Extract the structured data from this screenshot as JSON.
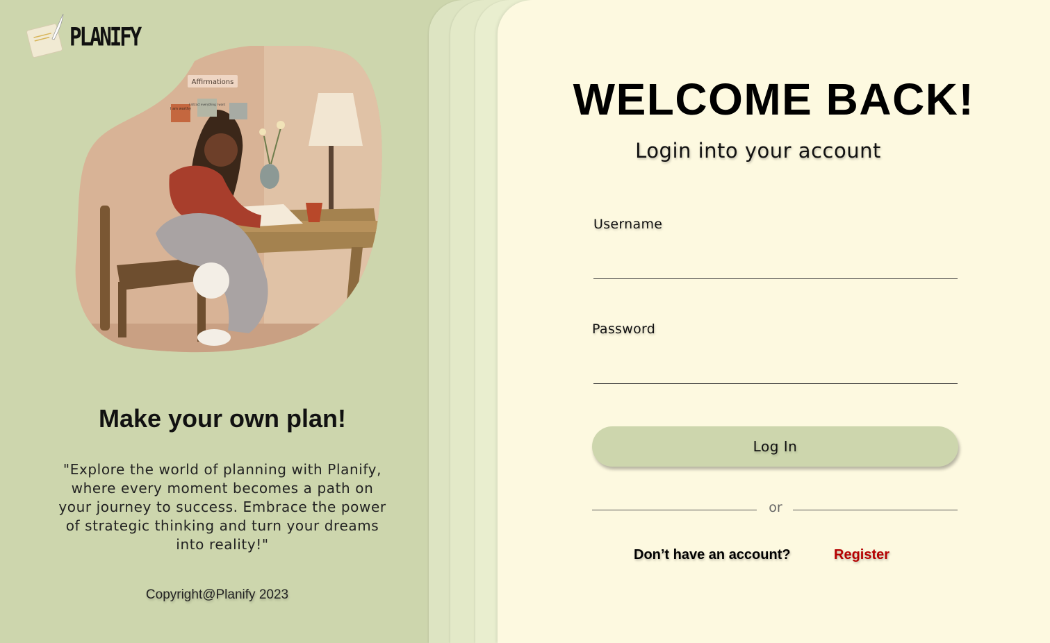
{
  "brand": {
    "name": "PLANIFY",
    "logo_icon": "notepad-quill-icon"
  },
  "illustration": {
    "icon": "woman-writing-at-desk-illustration",
    "wall_note_text": "Affirmations",
    "sticky_note_1": "I am worthy",
    "sticky_note_2": "I attract everything I want"
  },
  "left": {
    "tagline": "Make your own plan!",
    "quote": "\"Explore the world of planning with Planify, where every moment becomes a path on your journey to success. Embrace the power of strategic thinking and turn your dreams into reality!\"",
    "copyright": "Copyright@Planify 2023"
  },
  "login": {
    "title": "WELCOME BACK!",
    "subtitle": "Login into your account",
    "username_label": "Username",
    "username_value": "",
    "password_label": "Password",
    "password_value": "",
    "login_button": "Log In",
    "divider": "or",
    "register_prompt": "Don’t have an account?",
    "register_link": "Register"
  },
  "colors": {
    "sage_background": "#cdd6ad",
    "card_background": "#fdf9e0",
    "register_link": "#b50000"
  }
}
